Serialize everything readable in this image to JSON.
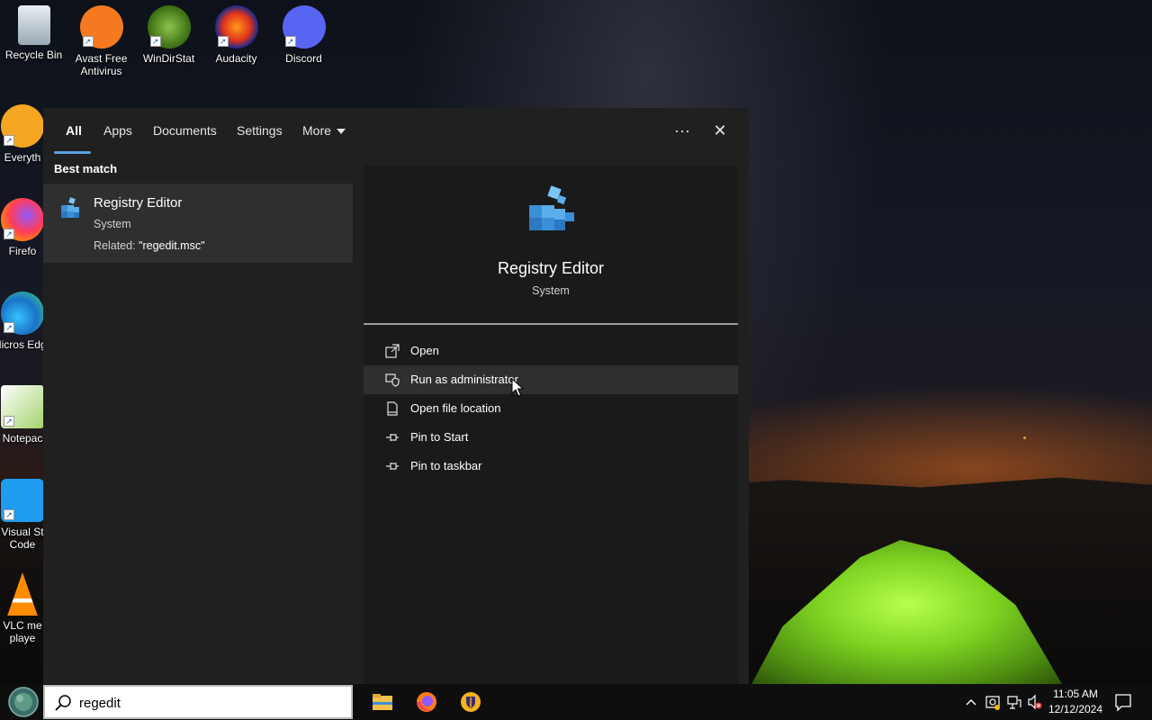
{
  "desktop": {
    "icons": [
      {
        "label": "Recycle Bin",
        "icon": "recycle-bin-icon"
      },
      {
        "label": "Avast Free Antivirus",
        "icon": "avast-icon"
      },
      {
        "label": "WinDirStat",
        "icon": "windirstat-icon"
      },
      {
        "label": "Audacity",
        "icon": "audacity-icon"
      },
      {
        "label": "Discord",
        "icon": "discord-icon"
      },
      {
        "label": "Everyth",
        "icon": "everything-icon"
      },
      {
        "label": "Firefo",
        "icon": "firefox-icon"
      },
      {
        "label": "Micros Edge",
        "icon": "edge-icon"
      },
      {
        "label": "Notepac",
        "icon": "notepad-plus-icon"
      },
      {
        "label": "Visual St Code",
        "icon": "vscode-icon"
      },
      {
        "label": "VLC me playe",
        "icon": "vlc-icon"
      }
    ]
  },
  "search_panel": {
    "tabs": [
      {
        "label": "All",
        "active": true
      },
      {
        "label": "Apps"
      },
      {
        "label": "Documents"
      },
      {
        "label": "Settings"
      },
      {
        "label": "More"
      }
    ],
    "more_options_glyph": "···",
    "close_glyph": "✕",
    "section_title": "Best match",
    "best_match": {
      "name": "Registry Editor",
      "type": "System",
      "related_prefix": "Related: ",
      "related_value": "\"regedit.msc\""
    },
    "detail": {
      "name": "Registry Editor",
      "type": "System",
      "actions": [
        {
          "label": "Open",
          "icon": "open-icon"
        },
        {
          "label": "Run as administrator",
          "icon": "shield-icon",
          "hover": true
        },
        {
          "label": "Open file location",
          "icon": "file-location-icon"
        },
        {
          "label": "Pin to Start",
          "icon": "pin-icon"
        },
        {
          "label": "Pin to taskbar",
          "icon": "pin-icon"
        }
      ]
    }
  },
  "taskbar": {
    "search_value": "regedit",
    "apps": [
      "file-explorer-icon",
      "firefox-icon",
      "bitwarden-icon"
    ],
    "tray_icons": [
      "chevron-up-icon",
      "defender-icon",
      "network-icon",
      "volume-muted-icon"
    ],
    "time": "11:05 AM",
    "date": "12/12/2024",
    "notification_icon": "notification-icon"
  },
  "colors": {
    "panel_bg": "#202020",
    "detail_bg": "#1a1a1a",
    "accent": "#5aa0e0",
    "hover_bg": "#2f2f2f"
  }
}
